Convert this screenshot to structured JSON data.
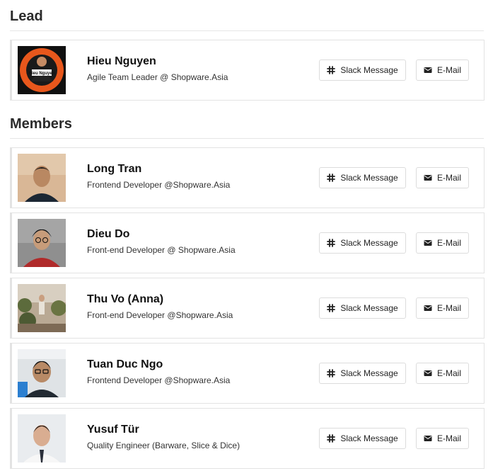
{
  "lead": {
    "heading": "Lead",
    "people": [
      {
        "name": "Hieu Nguyen",
        "role": "Agile Team Leader @ Shopware.Asia",
        "slack_label": "Slack Message",
        "mail_label": "E-Mail",
        "badge_text": "Hieu Nguyen"
      }
    ]
  },
  "members": {
    "heading": "Members",
    "people": [
      {
        "name": "Long Tran",
        "role": "Frontend Developer @Shopware.Asia",
        "slack_label": "Slack Message",
        "mail_label": "E-Mail"
      },
      {
        "name": "Dieu Do",
        "role": "Front-end Developer @ Shopware.Asia",
        "slack_label": "Slack Message",
        "mail_label": "E-Mail"
      },
      {
        "name": "Thu Vo (Anna)",
        "role": "Front-end Developer @Shopware.Asia",
        "slack_label": "Slack Message",
        "mail_label": "E-Mail"
      },
      {
        "name": "Tuan Duc Ngo",
        "role": "Frontend Developer @Shopware.Asia",
        "slack_label": "Slack Message",
        "mail_label": "E-Mail"
      },
      {
        "name": "Yusuf Tür",
        "role": "Quality Engineer (Barware, Slice & Dice)",
        "slack_label": "Slack Message",
        "mail_label": "E-Mail"
      }
    ]
  },
  "icons": {
    "slack": "slack-icon",
    "mail": "envelope-icon"
  },
  "colors": {
    "border": "#e3e3e3",
    "heading": "#2b2b2b",
    "text": "#111111"
  }
}
